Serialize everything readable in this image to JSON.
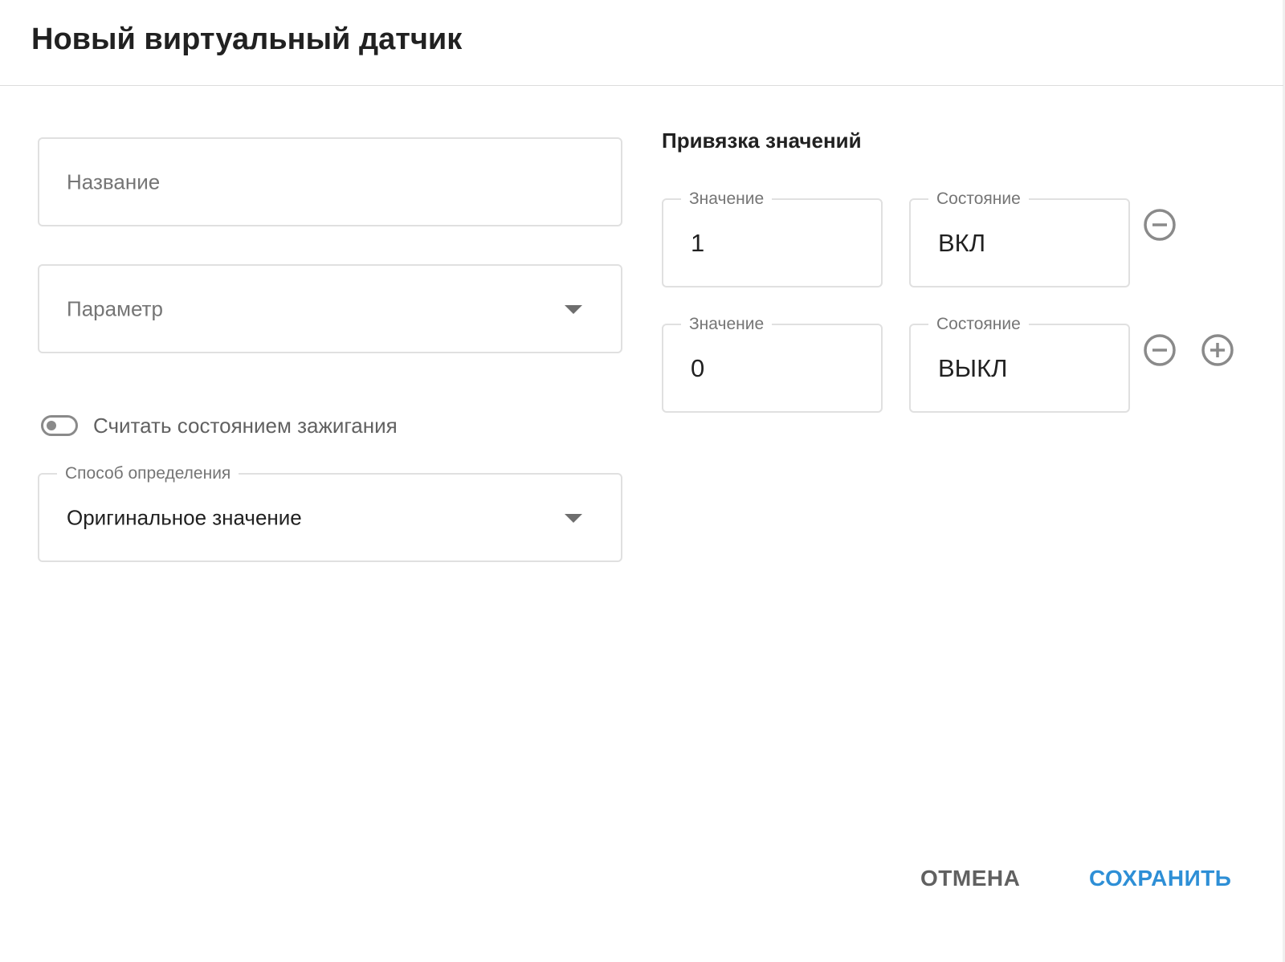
{
  "dialog": {
    "title": "Новый виртуальный датчик"
  },
  "form": {
    "name_field": {
      "placeholder": "Название",
      "value": ""
    },
    "parameter_field": {
      "placeholder": "Параметр",
      "value": ""
    },
    "ignition_toggle": {
      "label": "Считать состоянием зажигания",
      "checked": false
    },
    "method_field": {
      "label": "Способ определения",
      "value": "Оригинальное значение"
    }
  },
  "bindings": {
    "title": "Привязка значений",
    "rows": [
      {
        "value_label": "Значение",
        "value": "1",
        "state_label": "Состояние",
        "state": "ВКЛ",
        "remove_icon": "minus-circle-icon"
      },
      {
        "value_label": "Значение",
        "value": "0",
        "state_label": "Состояние",
        "state": "ВЫКЛ",
        "remove_icon": "minus-circle-icon",
        "add_icon": "plus-circle-icon"
      }
    ]
  },
  "actions": {
    "cancel_label": "ОТМЕНА",
    "save_label": "СОХРАНИТЬ"
  },
  "colors": {
    "accent": "#2e8fd6",
    "border": "#e0e0e0",
    "icon": "#8a8a8a"
  }
}
